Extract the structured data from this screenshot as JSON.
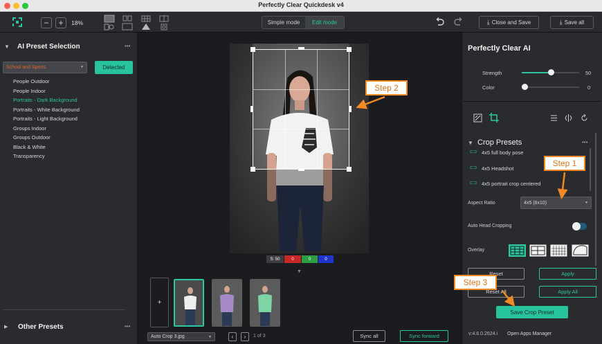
{
  "window": {
    "title": "Perfectly Clear Quickdesk v4"
  },
  "toolbar": {
    "zoom_level": "18%",
    "mode_simple": "Simple mode",
    "mode_edit": "Edit mode",
    "close_and_save": "Close and Save",
    "save_all": "Save all"
  },
  "left_panel": {
    "title": "AI Preset Selection",
    "category_value": "School and Sports",
    "detected_button": "Detected",
    "presets": [
      "People Outdoor",
      "People Indoor",
      "Portraits - Dark Background",
      "Portraits - White Background",
      "Portraits - Light Background",
      "Groups Indoor",
      "Groups Outdoor",
      "Black & White",
      "Transparency"
    ],
    "other_presets_title": "Other Presets",
    "more_glyph": "•••",
    "collapse_glyph": "▼",
    "expand_glyph": "▶"
  },
  "center": {
    "photo_caption": "S: 50",
    "chip_red": "0",
    "chip_green": "0",
    "chip_blue": "0",
    "add_label": "+",
    "file_select_value": "Auto Crop 3.jpg",
    "pagination": "1 of 3",
    "sync_all": "Sync all",
    "sync_forward": "Sync forward"
  },
  "right_panel": {
    "title": "Perfectly Clear AI",
    "strength_label": "Strength",
    "strength_value": "50",
    "strength_fraction": 0.5,
    "color_label": "Color",
    "color_value": "0",
    "color_fraction": 0.0,
    "crop_presets_title": "Crop Presets",
    "crop_presets": [
      "4x5 full body pose",
      "4x5 Headshot",
      "4x5 portrait crop centered"
    ],
    "aspect_ratio_label": "Aspect Ratio",
    "aspect_ratio_value": "4x5 (8x10)",
    "auto_head_cropping_label": "Auto Head Cropping",
    "overlay_label": "Overlay",
    "reset": "Reset",
    "apply": "Apply",
    "reset_all": "Reset All",
    "apply_all": "Apply All",
    "save_crop_preset": "Save Crop Preset",
    "version": "v:4.6.0.2624.i",
    "open_apps_manager": "Open Apps Manager"
  },
  "annotations": {
    "step1": "Step 1",
    "step2": "Step 2",
    "step3": "Step 3"
  },
  "colors": {
    "accent_teal": "#2bc7a0",
    "preset_selected": "#2bc7a0",
    "category_orange": "#e0662a",
    "annotation_orange": "#f08a23"
  }
}
